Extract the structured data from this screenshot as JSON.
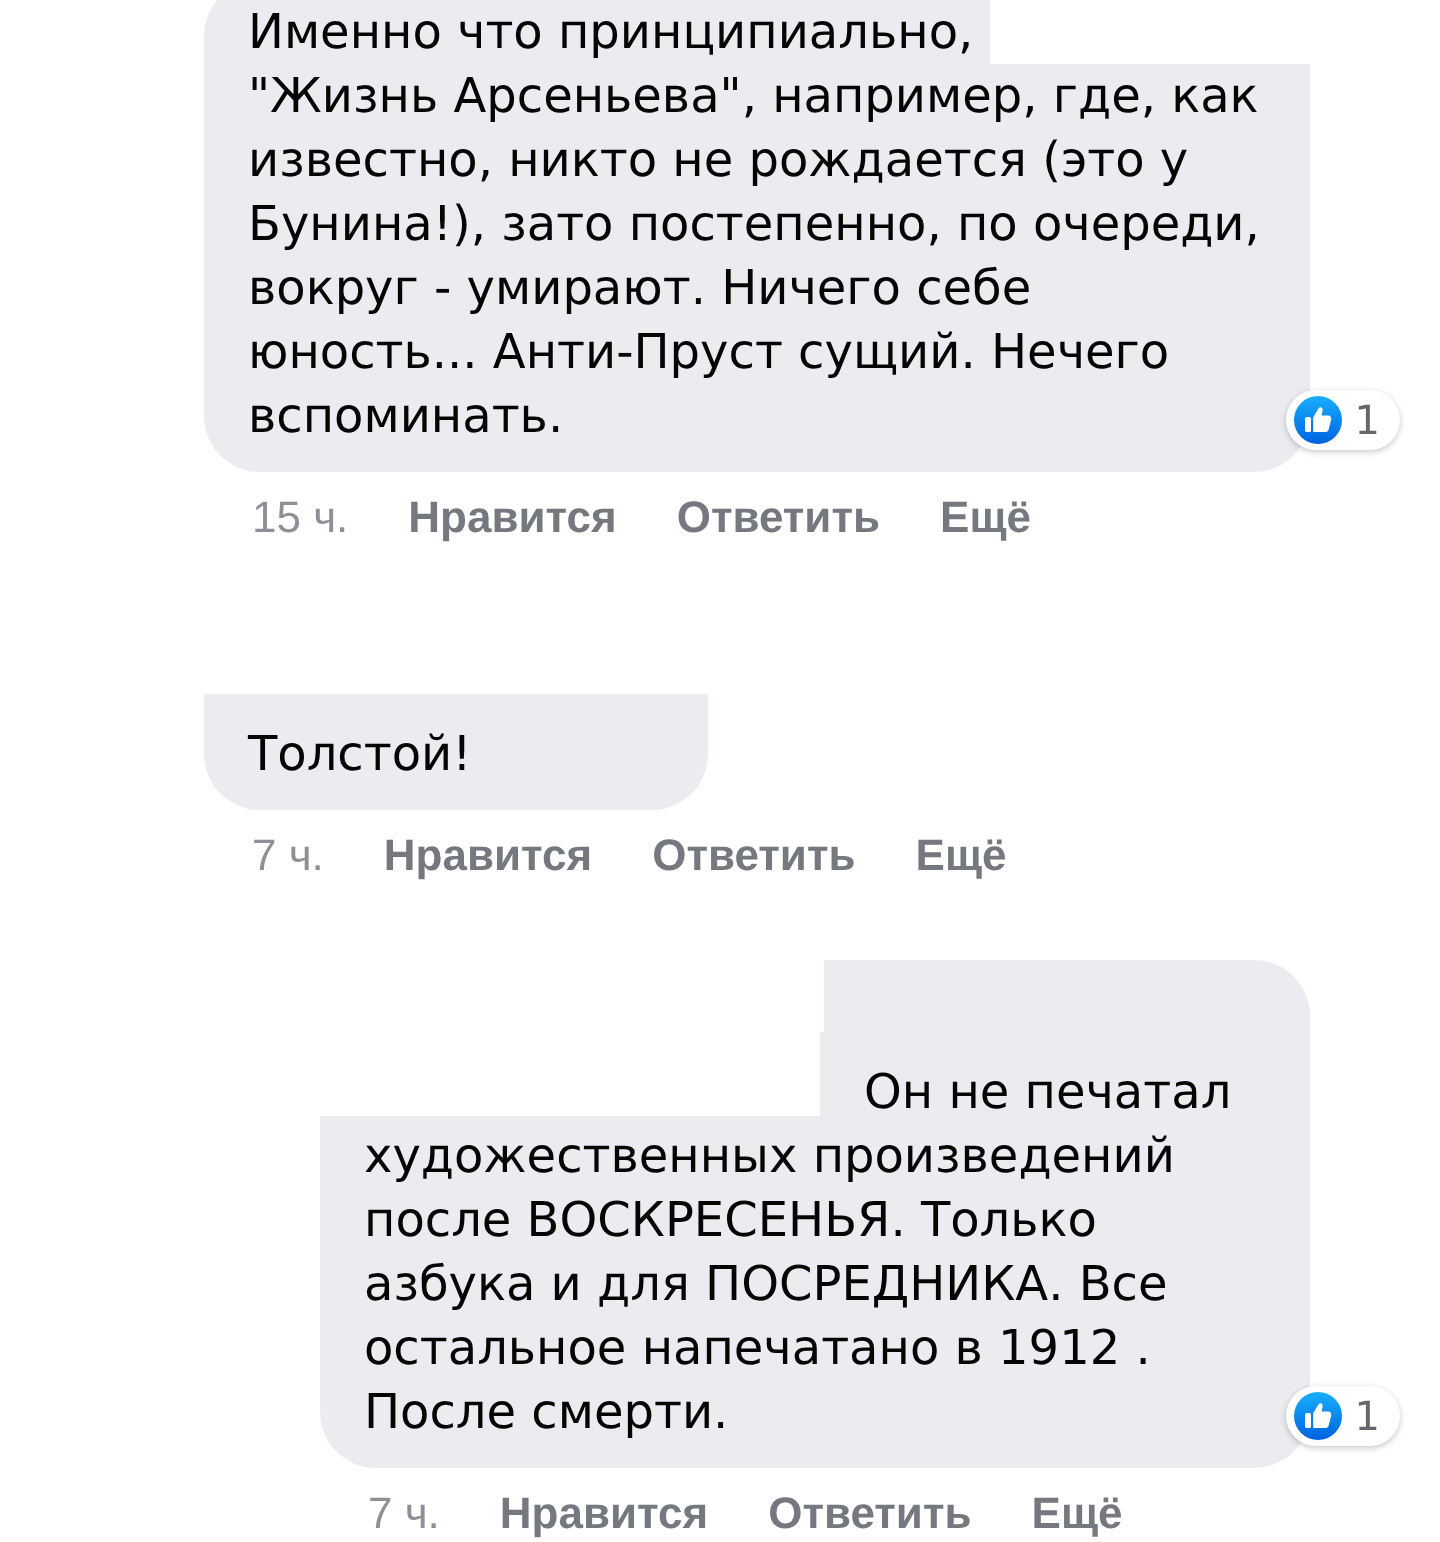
{
  "comments": [
    {
      "segments": [
        {
          "kind": "text",
          "text": "Именно что принципиально,"
        },
        {
          "kind": "hidden_mention"
        },
        {
          "kind": "text",
          "text": "\"Жизнь Арсеньева\", например, где, как известно, никто не рождается (это у Бунина!), зато постепенно, по очереди, вокруг - умирают. Ничего себе юность... Анти-Пруст сущий. Нечего вспоминать."
        }
      ],
      "reactions": {
        "count": "1"
      },
      "time": "15 ч.",
      "actions": [
        "Нравится",
        "Ответить",
        "Ещё"
      ]
    },
    {
      "segments": [
        {
          "kind": "hidden_name"
        },
        {
          "kind": "text",
          "text": "Толстой!"
        }
      ],
      "time": "7 ч.",
      "actions": [
        "Нравится",
        "Ответить",
        "Ещё"
      ],
      "children": [
        {
          "segments": [
            {
              "kind": "hidden_name"
            },
            {
              "kind": "hidden_mention"
            },
            {
              "kind": "text",
              "text": "Он не печатал художественных произведений после ВОСКРЕСЕНЬЯ. Только азбука и для ПОСРЕДНИКА. Все остальное напечатано в 1912 . После смерти."
            }
          ],
          "reactions": {
            "count": "1"
          },
          "time": "7 ч.",
          "actions": [
            "Нравится",
            "Ответить",
            "Ещё"
          ]
        }
      ]
    }
  ]
}
